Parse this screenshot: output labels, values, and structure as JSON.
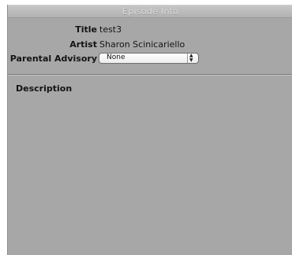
{
  "window": {
    "title": "Episode Info"
  },
  "fields": {
    "title_label": "Title",
    "title_value": "test3",
    "artist_label": "Artist",
    "artist_value": "Sharon Scinicariello",
    "parental_label": "Parental Advisory",
    "parental_value": "None"
  },
  "description": {
    "label": "Description"
  },
  "icons": {
    "select_arrows": "updown-arrows-icon"
  }
}
